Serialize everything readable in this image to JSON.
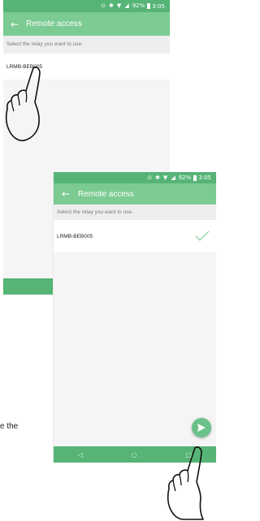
{
  "status_bar": {
    "battery": "92%",
    "time": "3:05"
  },
  "app_bar": {
    "title": "Remote access",
    "back_icon": "back-arrow-icon"
  },
  "hint": "Select the relay you want to use.",
  "relay": {
    "name": "LRMB-BEB005",
    "selected_icon": "check-icon"
  },
  "nav": {
    "back": "◁",
    "home": "○",
    "recents": "□"
  },
  "fab_icon": "send-icon",
  "caption_fragment": "e the",
  "colors": {
    "status_bar": "#56b476",
    "app_bar": "#7ccb93",
    "fab": "#6cc18a",
    "check": "#8dd3a2"
  }
}
